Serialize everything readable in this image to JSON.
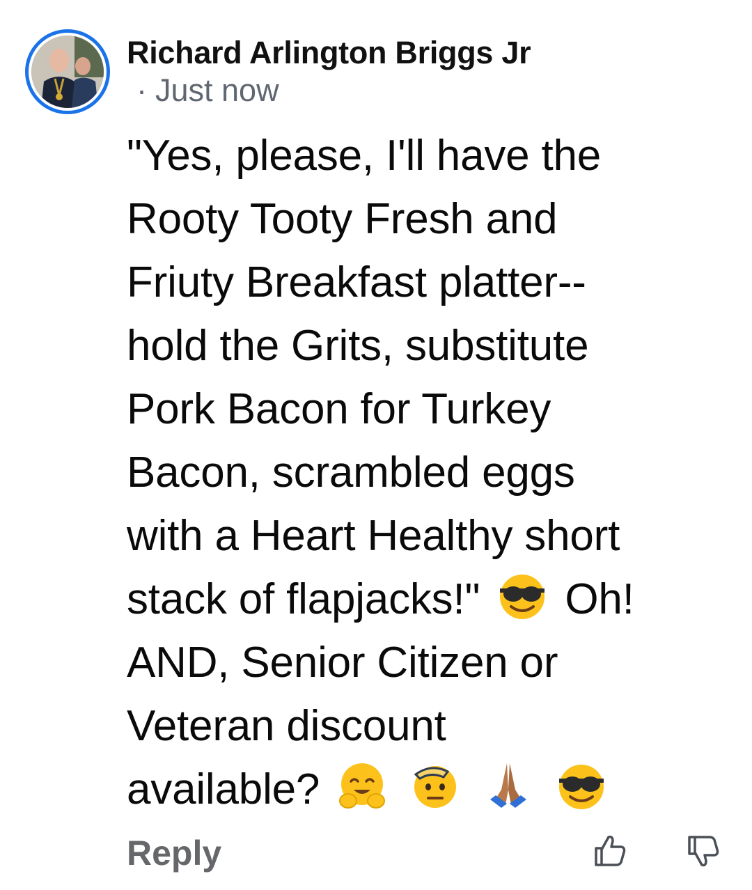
{
  "comment": {
    "author": "Richard Arlington Briggs Jr",
    "timestamp_sep": "·",
    "timestamp": "Just now",
    "lines": {
      "l1": "\"Yes, please, I'll have the",
      "l2": "Rooty Tooty Fresh and",
      "l3": "Friuty Breakfast platter--",
      "l4": "hold the Grits, substitute",
      "l5": "Pork Bacon for Turkey",
      "l6": "Bacon, scrambled eggs",
      "l7": "with a Heart Healthy short",
      "l8a": "stack of flapjacks!\"",
      "l8b": "Oh!",
      "l9": "AND, Senior Citizen or",
      "l10": "Veteran discount",
      "l11": "available?"
    },
    "emojis": [
      "smiling-face-with-sunglasses",
      "hugging-face",
      "saluting-face",
      "folded-hands",
      "smiling-face-with-sunglasses"
    ]
  },
  "actions": {
    "reply_label": "Reply",
    "like_icon": "thumbs-up-icon",
    "dislike_icon": "thumbs-down-icon"
  },
  "colors": {
    "avatar_ring": "#1a73e8",
    "timestamp": "#606770",
    "reply": "#65676b"
  }
}
